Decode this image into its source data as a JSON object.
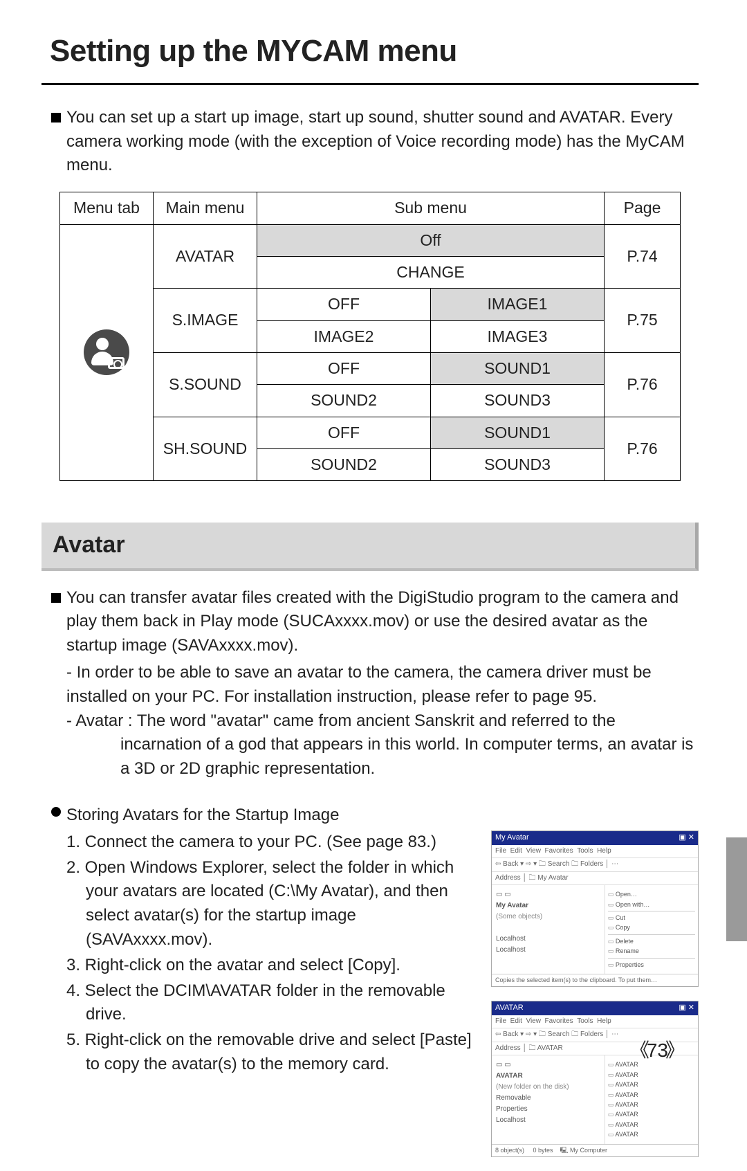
{
  "header": {
    "title": "Setting up the MYCAM menu"
  },
  "intro": "You can set up a start up image, start up sound, shutter sound and AVATAR. Every camera working mode (with the exception of Voice recording mode) has the MyCAM menu.",
  "table": {
    "headers": {
      "menutab": "Menu tab",
      "main": "Main menu",
      "sub": "Sub menu",
      "page": "Page"
    },
    "rows": [
      {
        "main": "AVATAR",
        "sub": [
          "Off",
          "CHANGE"
        ],
        "page": "P.74"
      },
      {
        "main": "S.IMAGE",
        "sub": [
          "OFF",
          "IMAGE1",
          "IMAGE2",
          "IMAGE3"
        ],
        "page": "P.75"
      },
      {
        "main": "S.SOUND",
        "sub": [
          "OFF",
          "SOUND1",
          "SOUND2",
          "SOUND3"
        ],
        "page": "P.76"
      },
      {
        "main": "SH.SOUND",
        "sub": [
          "OFF",
          "SOUND1",
          "SOUND2",
          "SOUND3"
        ],
        "page": "P.76"
      }
    ]
  },
  "avatar_heading": "Avatar",
  "avatar_intro": {
    "main": "You can transfer avatar files created with the DigiStudio program to the camera and play them back in Play mode (SUCAxxxx.mov) or use the desired avatar as the startup image (SAVAxxxx.mov).",
    "note1": "- In order to be able to save an avatar to the camera, the camera driver must be installed on your PC. For installation instruction, please refer to page 95.",
    "note2": "- Avatar : The word \"avatar\" came from ancient Sanskrit and referred to the incarnation of a god that appears in this world. In computer terms, an avatar is a 3D or 2D graphic representation."
  },
  "storing": {
    "title": "Storing Avatars for the Startup Image",
    "steps": [
      "1. Connect the camera to your PC. (See page 83.)",
      "2. Open Windows Explorer, select the folder in which your avatars are located (C:\\My Avatar), and then select avatar(s) for the startup image (SAVAxxxx.mov).",
      "3. Right-click on the avatar and select [Copy].",
      "4. Select the DCIM\\AVATAR folder in the removable drive.",
      "5. Right-click on the removable drive and select [Paste] to copy the avatar(s) to the memory card."
    ]
  },
  "thumbs": {
    "win1": {
      "title": "My Avatar",
      "tree": [
        "□ □",
        "My Avatar",
        "(Some objects)",
        "–",
        "Localhost",
        "Localhost"
      ],
      "files": [
        "Open…",
        "Open with…",
        "–",
        "Cut",
        "Copy",
        "–",
        "Delete",
        "Rename",
        "–",
        "Properties"
      ]
    },
    "win2": {
      "title": "AVATAR",
      "tree": [
        "□ □",
        "AVATAR",
        "(New folder on the disk)",
        "Removable",
        "Properties",
        "Localhost"
      ],
      "files": [
        "AVATAR",
        "AVATAR",
        "AVATAR",
        "AVATAR",
        "AVATAR",
        "AVATAR",
        "AVATAR",
        "AVATAR"
      ]
    }
  },
  "page_number": "73"
}
